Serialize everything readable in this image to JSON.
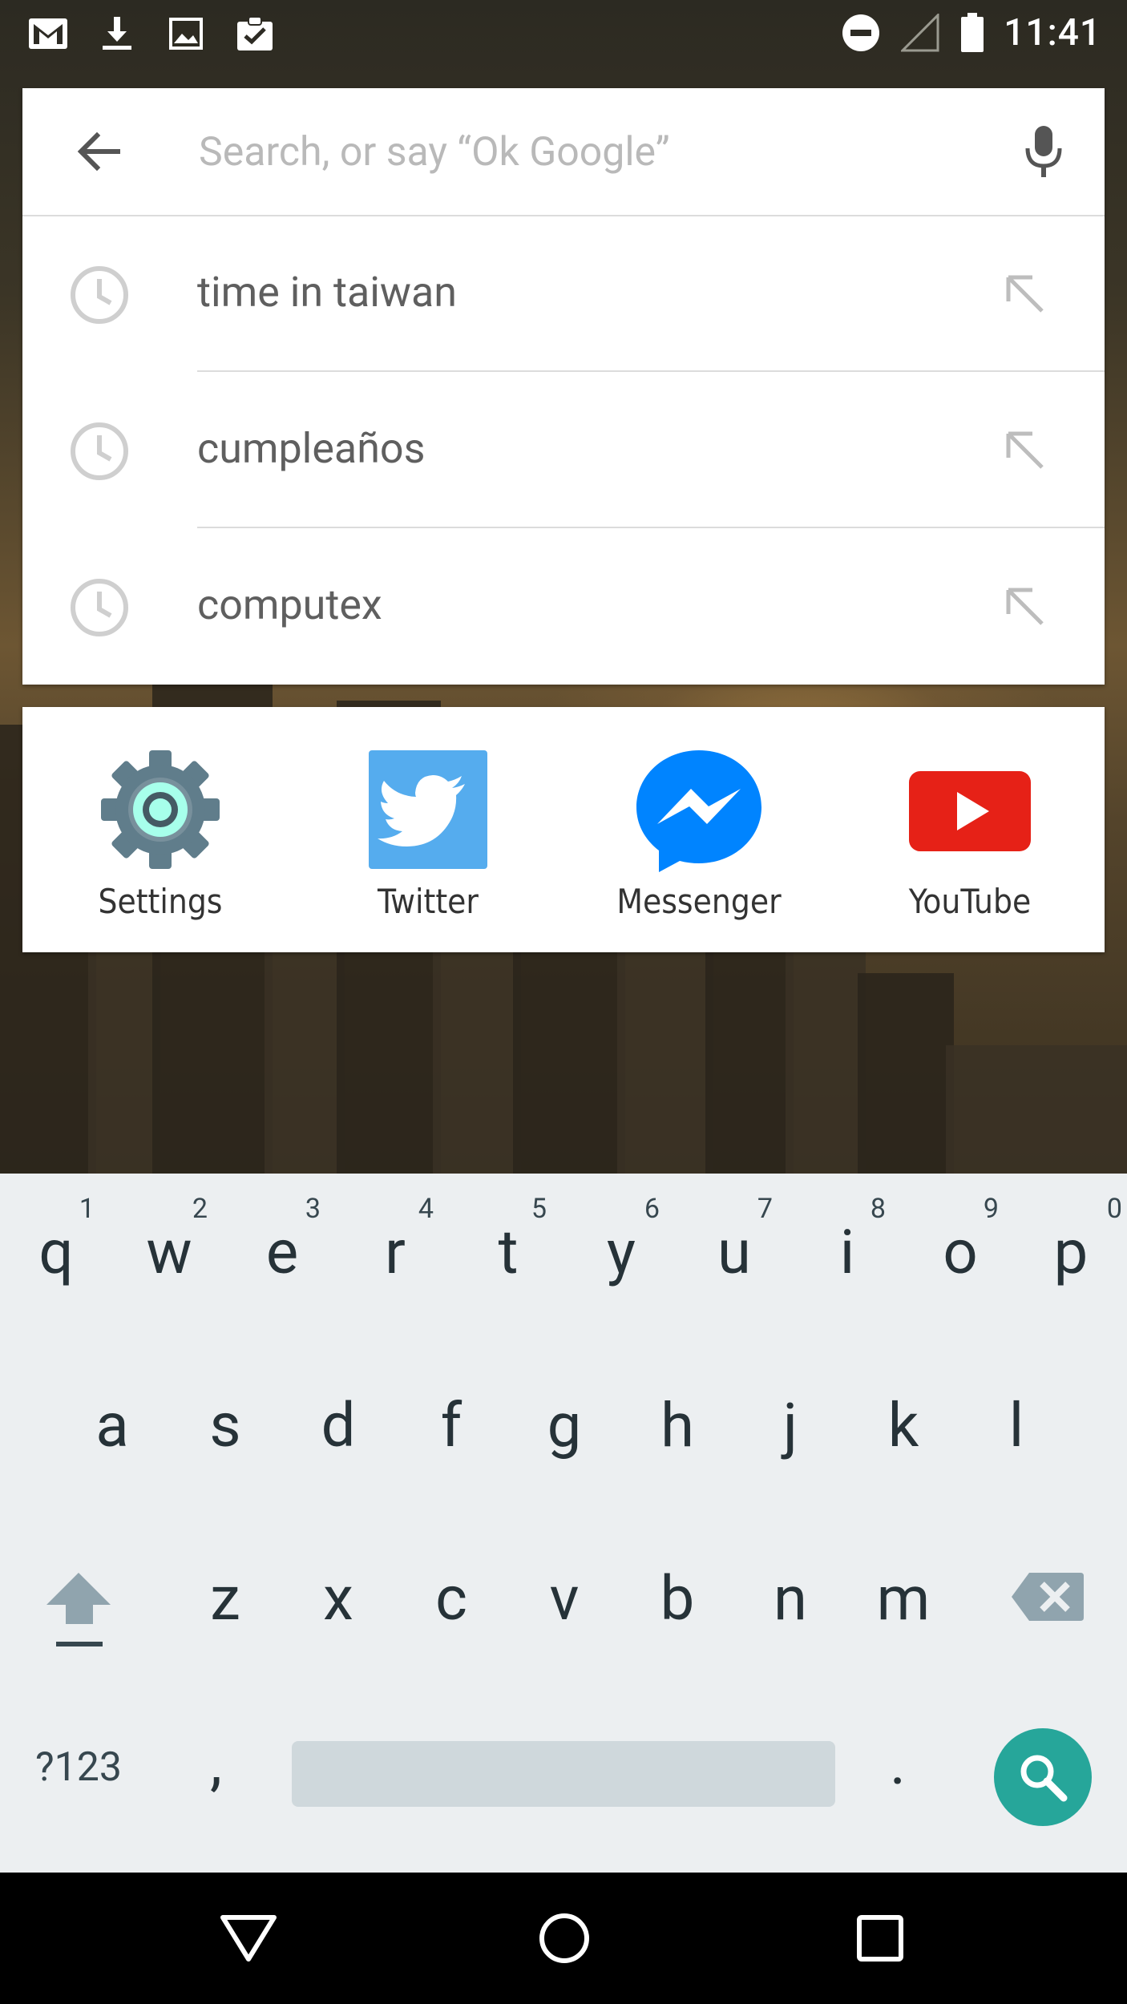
{
  "status_bar": {
    "time": "11:41",
    "left_icons": [
      "gmail-icon",
      "download-icon",
      "image-icon",
      "clipboard-check-icon"
    ],
    "right_icons": [
      "do-not-disturb-icon",
      "signal-icon",
      "battery-icon"
    ]
  },
  "search": {
    "placeholder": "Search, or say “Ok Google”",
    "value": ""
  },
  "suggestions": [
    {
      "text": "time in taiwan"
    },
    {
      "text": "cumpleaños"
    },
    {
      "text": "computex"
    }
  ],
  "apps": [
    {
      "name": "Settings",
      "icon": "settings-gear-icon"
    },
    {
      "name": "Twitter",
      "icon": "twitter-bird-icon"
    },
    {
      "name": "Messenger",
      "icon": "messenger-bolt-icon"
    },
    {
      "name": "YouTube",
      "icon": "youtube-play-icon"
    }
  ],
  "keyboard": {
    "row1": [
      {
        "key": "q",
        "num": "1"
      },
      {
        "key": "w",
        "num": "2"
      },
      {
        "key": "e",
        "num": "3"
      },
      {
        "key": "r",
        "num": "4"
      },
      {
        "key": "t",
        "num": "5"
      },
      {
        "key": "y",
        "num": "6"
      },
      {
        "key": "u",
        "num": "7"
      },
      {
        "key": "i",
        "num": "8"
      },
      {
        "key": "o",
        "num": "9"
      },
      {
        "key": "p",
        "num": "0"
      }
    ],
    "row2": [
      "a",
      "s",
      "d",
      "f",
      "g",
      "h",
      "j",
      "k",
      "l"
    ],
    "row3": [
      "z",
      "x",
      "c",
      "v",
      "b",
      "n",
      "m"
    ],
    "symbols_label": "?123",
    "comma": ",",
    "period": "."
  },
  "colors": {
    "enter_key": "#26a69a",
    "keyboard_bg": "#eceff1",
    "youtube_red": "#e62117",
    "twitter_blue": "#55acee",
    "messenger_blue": "#0084ff"
  }
}
